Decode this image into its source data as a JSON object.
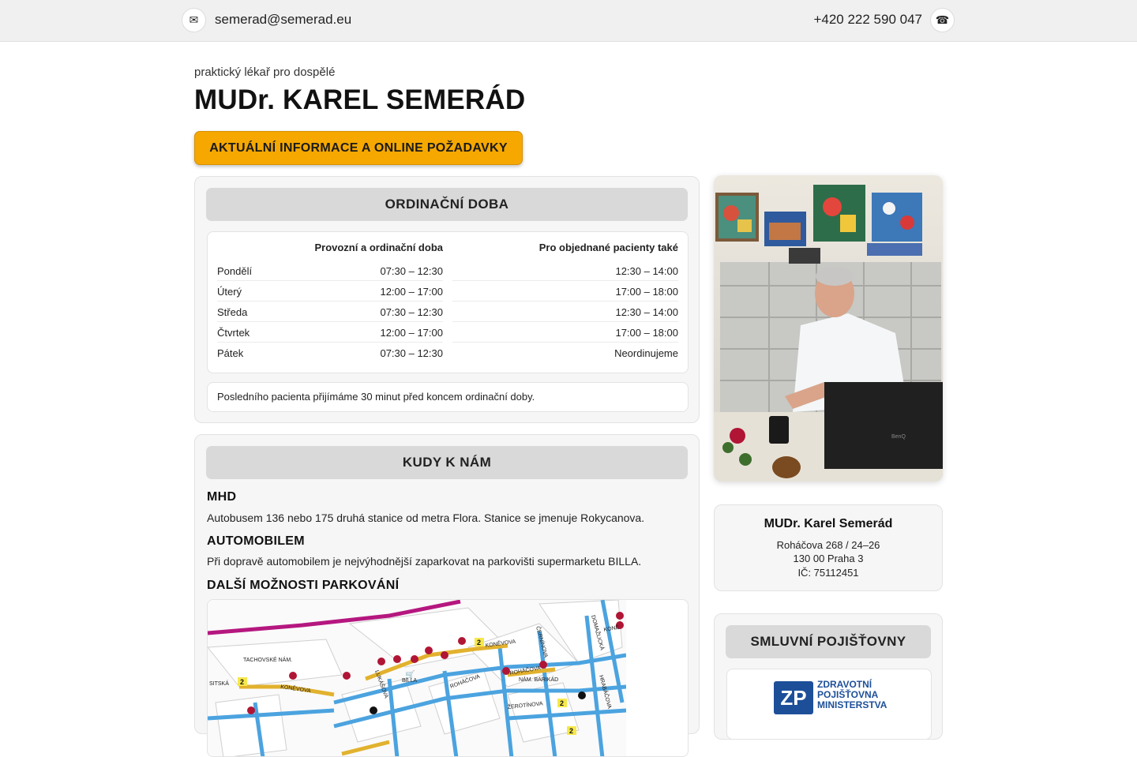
{
  "topbar": {
    "email": "semerad@semerad.eu",
    "phone": "+420 222 590 047",
    "email_icon": "envelope-icon",
    "phone_icon": "phone-icon"
  },
  "header": {
    "subtitle": "praktický lékař pro dospělé",
    "title": "MUDr. KAREL SEMERÁD",
    "cta_label": "AKTUÁLNÍ INFORMACE A ONLINE POŽADAVKY"
  },
  "hours": {
    "heading": "ORDINAČNÍ DOBA",
    "col1_label": "Provozní a ordinační doba",
    "col2_label": "Pro objednané pacienty také",
    "rows": [
      {
        "day": "Pondělí",
        "regular": "07:30 – 12:30",
        "appointments": "12:30 – 14:00"
      },
      {
        "day": "Úterý",
        "regular": "12:00 – 17:00",
        "appointments": "17:00 – 18:00"
      },
      {
        "day": "Středa",
        "regular": "07:30 – 12:30",
        "appointments": "12:30 – 14:00"
      },
      {
        "day": "Čtvrtek",
        "regular": "12:00 – 17:00",
        "appointments": "17:00 – 18:00"
      },
      {
        "day": "Pátek",
        "regular": "07:30 – 12:30",
        "appointments": "Neordinujeme"
      }
    ],
    "note": "Posledního pacienta přijímáme 30 minut před koncem ordinační doby."
  },
  "directions": {
    "heading": "KUDY K NÁM",
    "mhd_title": "MHD",
    "mhd_text": "Autobusem 136 nebo 175 druhá stanice od metra Flora. Stanice se jmenuje Rokycanova.",
    "car_title": "AUTOMOBILEM",
    "car_text": "Při dopravě automobilem je nejvýhodnější zaparkovat na parkovišti supermarketu BILLA.",
    "parking_title": "DALŠÍ MOŽNOSTI PARKOVÁNÍ",
    "map_labels": {
      "tachovske": "TACHOVSKÉ NÁM.",
      "sitska": "SITSKÁ",
      "konevova_w": "KONĚVOVA",
      "konevova_e": "KONĚVOVA",
      "billa": "BILLA",
      "rohacova": "ROHÁČOVA",
      "rohacova_2": "ROHÁČOVA",
      "barikad": "NÁM. BARIKÁD",
      "zerotinova": "ŽEROTÍNOVA",
      "cerninova": "ČERNÍNOVA",
      "lukasova": "LUKÁŠOVA",
      "domazlicka": "DOMAŽLICKÁ",
      "hrabacova": "HRABÁČOVA",
      "kone": "KONĚ",
      "zone_number": "2"
    }
  },
  "doctor": {
    "name": "MUDr. Karel Semerád",
    "street": "Roháčova 268 / 24–26",
    "city": "130 00 Praha 3",
    "ico": "IČ: 75112451",
    "monitor_brand": "BenQ"
  },
  "insurers": {
    "heading": "SMLUVNÍ POJIŠŤOVNY",
    "logo_lines": [
      "ZDRAVOTNÍ",
      "POJIŠŤOVNA",
      "MINISTERSTVA"
    ],
    "logo_mark": "ZP"
  },
  "colors": {
    "accent": "#f6a800",
    "header_bg": "#d9d9d9",
    "insurer_blue": "#1d4f99"
  }
}
